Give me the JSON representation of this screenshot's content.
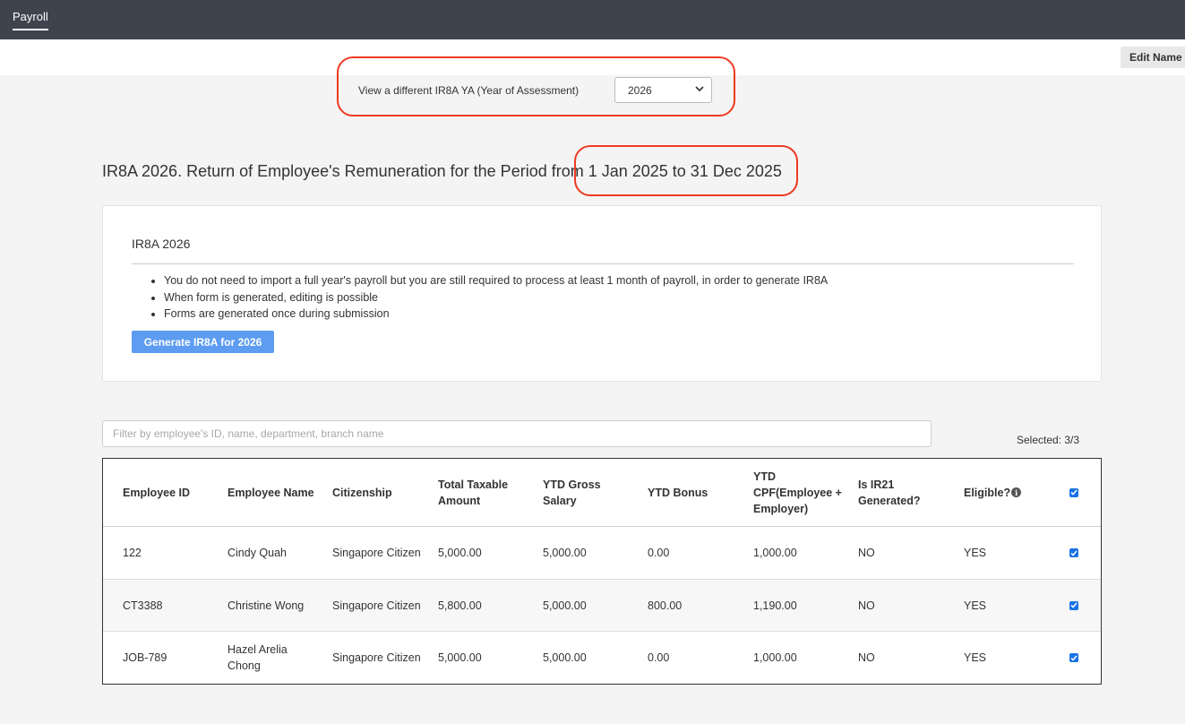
{
  "topbar": {
    "tab_label": "Payroll"
  },
  "header": {
    "edit_name_label": "Edit Name"
  },
  "ya_selector": {
    "label": "View a different IR8A YA (Year of Assessment)",
    "selected": "2026"
  },
  "page_title": {
    "prefix": "IR8A 2026. Return of Employee's Remuneration for the Period from ",
    "period": "1 Jan 2025 to 31 Dec 2025"
  },
  "card": {
    "title": "IR8A 2026",
    "bullets": [
      "You do not need to import a full year's payroll but you are still required to process at least 1 month of payroll, in order to generate IR8A",
      "When form is generated, editing is possible",
      "Forms are generated once during submission"
    ],
    "generate_button": "Generate IR8A for 2026"
  },
  "filter": {
    "placeholder": "Filter by employee's ID, name, department, branch name",
    "value": ""
  },
  "selected_count": "Selected: 3/3",
  "table": {
    "columns": [
      "Employee ID",
      "Employee Name",
      "Citizenship",
      "Total Taxable Amount",
      "YTD Gross Salary",
      "YTD Bonus",
      "YTD CPF(Employee + Employer)",
      "Is IR21 Generated?",
      "Eligible?"
    ],
    "header_checked": true,
    "rows": [
      {
        "id": "122",
        "name": "Cindy Quah",
        "citizenship": "Singapore Citizen",
        "taxable": "5,000.00",
        "gross": "5,000.00",
        "bonus": "0.00",
        "cpf": "1,000.00",
        "ir21": "NO",
        "eligible": "YES",
        "checked": true
      },
      {
        "id": "CT3388",
        "name": "Christine Wong",
        "citizenship": "Singapore Citizen",
        "taxable": "5,800.00",
        "gross": "5,000.00",
        "bonus": "800.00",
        "cpf": "1,190.00",
        "ir21": "NO",
        "eligible": "YES",
        "checked": true
      },
      {
        "id": "JOB-789",
        "name": "Hazel Arelia Chong",
        "citizenship": "Singapore Citizen",
        "taxable": "5,000.00",
        "gross": "5,000.00",
        "bonus": "0.00",
        "cpf": "1,000.00",
        "ir21": "NO",
        "eligible": "YES",
        "checked": true
      }
    ]
  },
  "colors": {
    "topbar": "#3f434e",
    "primary_button": "#5d9cf0",
    "annotation": "#ee3a22",
    "checkbox": "#1a73e8"
  }
}
